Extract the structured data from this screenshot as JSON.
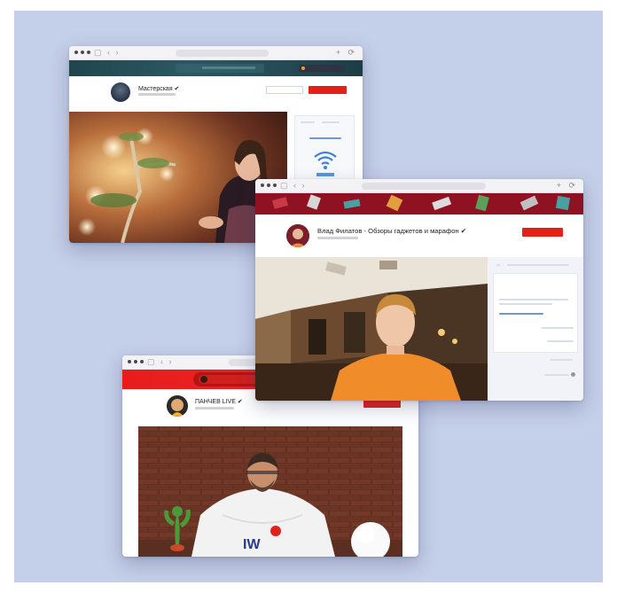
{
  "palette": {
    "background": "#c4cfe9",
    "subscribe_red": "#e3211a",
    "banner_teal": "#20464d",
    "banner_maroon": "#8f1222",
    "banner_red": "#e81c1c"
  },
  "windows": [
    {
      "id": "win1",
      "icons": [
        "window-dots-icon",
        "nav-icons",
        "reload-icon",
        "shield-icon"
      ],
      "channel": {
        "name": "Мастерская ✔",
        "subscribers": "",
        "buttons": [
          "outline-button",
          "subscribe-button"
        ]
      },
      "panel": {
        "icons": [
          "wifi-icon"
        ]
      },
      "video": "woman with glowing lights"
    },
    {
      "id": "win2",
      "icons": [
        "window-dots-icon",
        "nav-icons",
        "reload-icon",
        "shield-icon"
      ],
      "channel": {
        "name": "Влад Филатов - Обзоры гаджетов и марафон ✔",
        "subscribers": "",
        "buttons": [
          "subscribe-button"
        ]
      },
      "video": "man in orange t-shirt"
    },
    {
      "id": "win3",
      "icons": [
        "window-dots-icon",
        "nav-icons",
        "reload-icon",
        "shield-icon"
      ],
      "channel": {
        "name": "ПАНЧЕВ LIVE ✔",
        "subscribers": "",
        "buttons": [
          "subscribe-button"
        ]
      },
      "video": "man in white hoodie with cactus toy"
    }
  ]
}
